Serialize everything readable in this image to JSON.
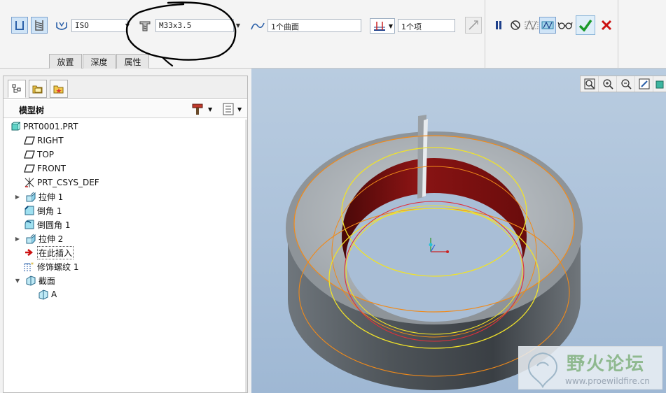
{
  "dashboard": {
    "thread_standard": "ISO",
    "thread_size": "M33x3.5",
    "surface_ref": "1个曲面",
    "edge_ref": "1个项",
    "tabs": [
      {
        "label": "放置"
      },
      {
        "label": "深度"
      },
      {
        "label": "属性"
      }
    ]
  },
  "navigator": {
    "tree_title": "模型树",
    "items": [
      {
        "label": "PRT0001.PRT",
        "icon": "part-icon",
        "expander": ""
      },
      {
        "label": "RIGHT",
        "icon": "datum-plane-icon",
        "expander": ""
      },
      {
        "label": "TOP",
        "icon": "datum-plane-icon",
        "expander": ""
      },
      {
        "label": "FRONT",
        "icon": "datum-plane-icon",
        "expander": ""
      },
      {
        "label": "PRT_CSYS_DEF",
        "icon": "csys-icon",
        "expander": ""
      },
      {
        "label": "拉伸 1",
        "icon": "extrude-icon",
        "expander": "▶"
      },
      {
        "label": "倒角 1",
        "icon": "chamfer-icon",
        "expander": ""
      },
      {
        "label": "倒圆角 1",
        "icon": "round-icon",
        "expander": ""
      },
      {
        "label": "拉伸 2",
        "icon": "extrude-icon",
        "expander": "▶"
      },
      {
        "label": "在此插入",
        "icon": "insert-here-arrow-icon",
        "expander": ""
      },
      {
        "label": "修饰螺纹 1",
        "icon": "cosmetic-thread-icon",
        "expander": ""
      },
      {
        "label": "截面",
        "icon": "section-icon",
        "expander": "▼"
      },
      {
        "label": "A",
        "icon": "section-icon",
        "expander": ""
      }
    ]
  },
  "watermark": {
    "title": "野火论坛",
    "url": "www.proewildfire.cn"
  },
  "colors": {
    "accept": "#1a9a2a",
    "cancel": "#cc1111",
    "model_gray": "#8e9499",
    "inner_red": "#8a1414",
    "annotation_ink": "#000000"
  }
}
